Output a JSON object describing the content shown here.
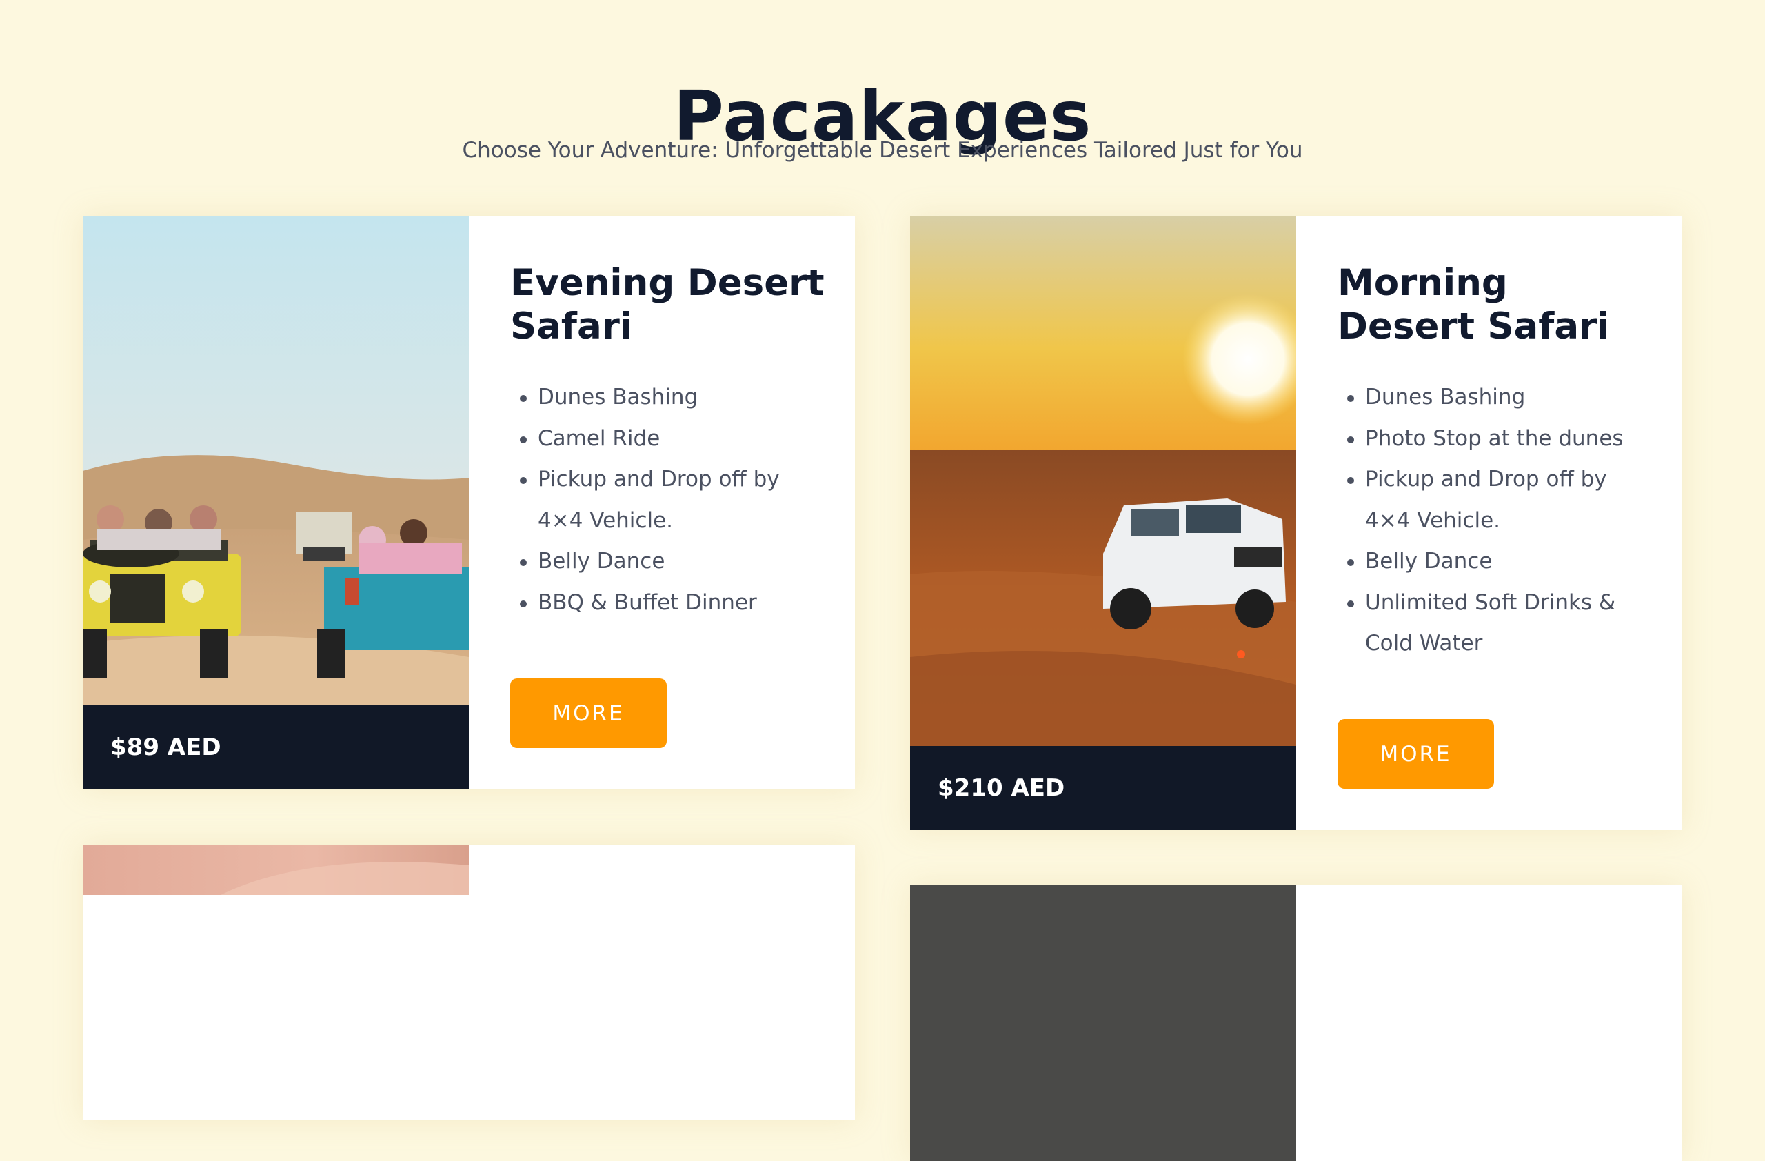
{
  "page": {
    "title": "Pacakages",
    "subtitle": "Choose Your Adventure: Unforgettable Desert Experiences Tailored Just for You"
  },
  "packages": [
    {
      "title": "Evening Desert Safari",
      "price": "$89 AED",
      "features": [
        "Dunes Bashing",
        "Camel Ride",
        "Pickup and Drop off by 4×4 Vehicle.",
        "Belly Dance",
        "BBQ & Buffet Dinner"
      ],
      "button": "MORE"
    },
    {
      "title": "Morning Desert Safari",
      "price": "$210 AED",
      "features": [
        "Dunes Bashing",
        "Photo Stop at the dunes",
        "Pickup and Drop off by 4×4 Vehicle.",
        "Belly Dance",
        "Unlimited Soft Drinks & Cold Water"
      ],
      "button": "MORE"
    }
  ],
  "colors": {
    "page_background": "#fdf8df",
    "heading": "#111a2e",
    "body_text": "#4b5161",
    "price_bar": "#111827",
    "accent_button": "#ff9900"
  }
}
